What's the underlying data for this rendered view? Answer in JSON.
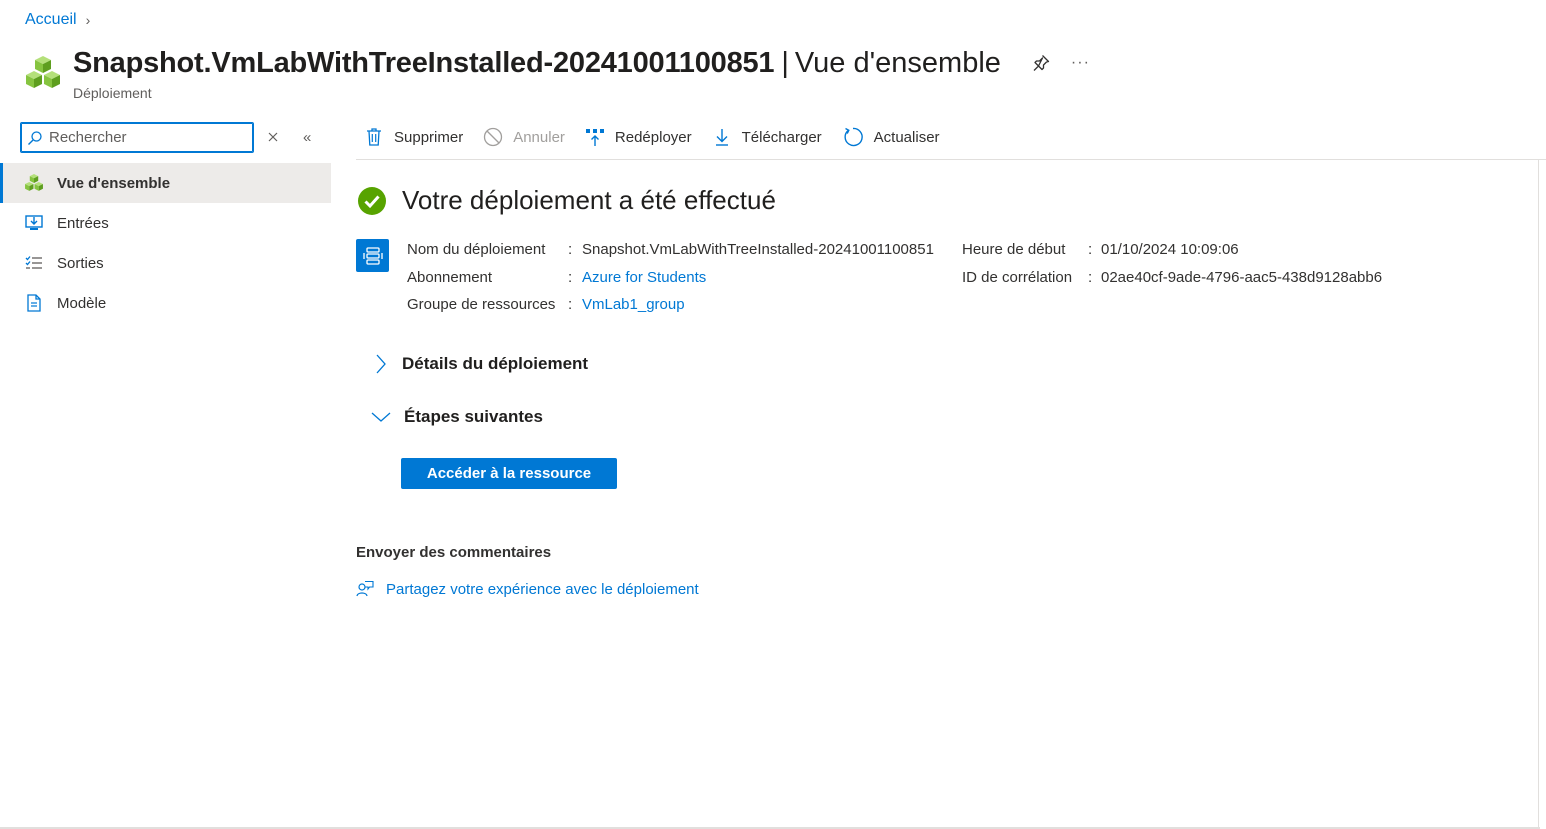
{
  "breadcrumb": {
    "home": "Accueil",
    "separator": "›"
  },
  "header": {
    "title": "Snapshot.VmLabWithTreeInstalled-20241001100851",
    "separator": "|",
    "section": "Vue d'ensemble",
    "subtitle": "Déploiement",
    "more": "···"
  },
  "search": {
    "placeholder": "Rechercher",
    "value": ""
  },
  "sidebar": {
    "collapse": "«",
    "items": [
      {
        "label": "Vue d'ensemble",
        "icon": "deployment-cubes-icon",
        "active": true
      },
      {
        "label": "Entrées",
        "icon": "inputs-icon"
      },
      {
        "label": "Sorties",
        "icon": "outputs-list-icon"
      },
      {
        "label": "Modèle",
        "icon": "template-document-icon"
      }
    ]
  },
  "toolbar": {
    "delete": "Supprimer",
    "cancel": "Annuler",
    "redeploy": "Redéployer",
    "download": "Télécharger",
    "refresh": "Actualiser"
  },
  "status": {
    "message": "Votre déploiement a été effectué"
  },
  "details": {
    "deployment_name_label": "Nom du déploiement",
    "deployment_name_value": "Snapshot.VmLabWithTreeInstalled-20241001100851",
    "subscription_label": "Abonnement",
    "subscription_value": "Azure for Students",
    "resource_group_label": "Groupe de ressources",
    "resource_group_value": "VmLab1_group",
    "start_time_label": "Heure de début",
    "start_time_value": "01/10/2024 10:09:06",
    "correlation_label": "ID de corrélation",
    "correlation_value": "02ae40cf-9ade-4796-aac5-438d9128abb6",
    "colon": ":"
  },
  "sections": {
    "details_title": "Détails du déploiement",
    "next_steps_title": "Étapes suivantes",
    "go_to_resource": "Accéder à la ressource"
  },
  "feedback": {
    "title": "Envoyer des commentaires",
    "link": "Partagez votre expérience avec le déploiement"
  },
  "colors": {
    "accent": "#0078d4",
    "success": "#57a300",
    "cube_green": "#86c440"
  }
}
